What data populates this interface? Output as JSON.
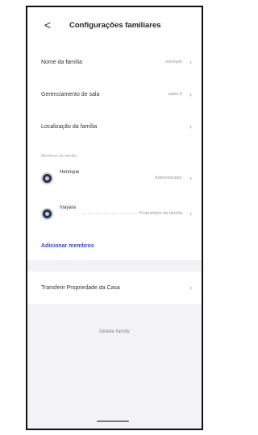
{
  "header": {
    "back_glyph": "<",
    "title": "Configurações familiares"
  },
  "settings": {
    "items": [
      {
        "label": "Nome da família",
        "value": "exemplo"
      },
      {
        "label": "Gerenciamento de sala",
        "value": "salas:6"
      },
      {
        "label": "Localização da família",
        "value": ""
      }
    ]
  },
  "members": {
    "section_label": "Membros da família",
    "list": [
      {
        "name": "Henrique",
        "role": "Administrador"
      },
      {
        "name": "mayara",
        "role": "Proprietário da família"
      }
    ],
    "add_label": "Adicionar membros"
  },
  "transfer": {
    "label": "Transferir Propriedade da Casa"
  },
  "delete": {
    "label": "Delete family"
  },
  "icons": {
    "back": "chevron-left-icon",
    "row_chevron": "chevron-right-icon",
    "avatar": "user-avatar-icon"
  },
  "colors": {
    "accent": "#3a46c8",
    "background": "#f3f3f5"
  }
}
